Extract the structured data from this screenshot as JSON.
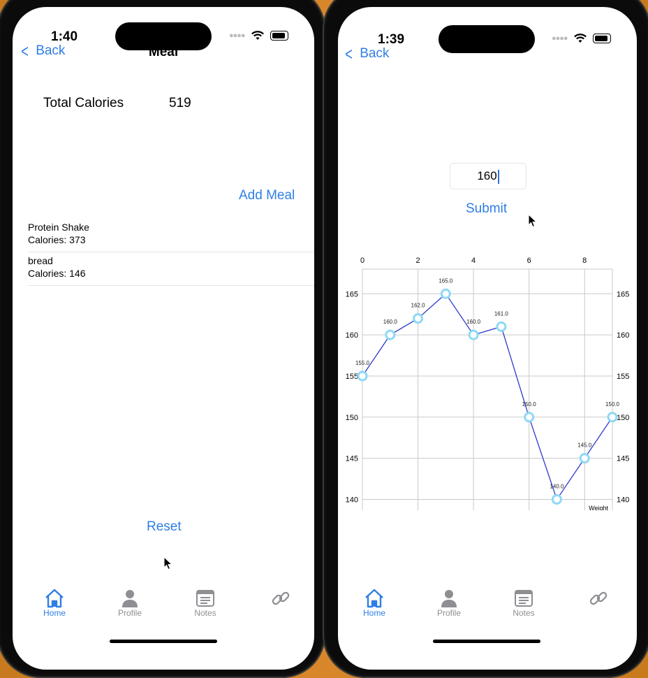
{
  "left": {
    "status": {
      "time": "1:40"
    },
    "nav": {
      "back": "Back",
      "title": "Meal"
    },
    "total_calories": {
      "label": "Total Calories",
      "value": "519"
    },
    "add_meal": "Add Meal",
    "meals": [
      {
        "name": "Protein Shake",
        "calories": "Calories: 373"
      },
      {
        "name": "bread",
        "calories": "Calories: 146"
      }
    ],
    "reset": "Reset",
    "tabs": [
      {
        "label": "Home",
        "icon": "home-icon",
        "active": true
      },
      {
        "label": "Profile",
        "icon": "person-icon",
        "active": false
      },
      {
        "label": "Notes",
        "icon": "notes-icon",
        "active": false
      },
      {
        "label": "",
        "icon": "link-icon",
        "active": false
      }
    ]
  },
  "right": {
    "status": {
      "time": "1:39"
    },
    "nav": {
      "back": "Back"
    },
    "weight_input": {
      "value": "160"
    },
    "submit": "Submit",
    "tabs": [
      {
        "label": "Home",
        "icon": "home-icon",
        "active": true
      },
      {
        "label": "Profile",
        "icon": "person-icon",
        "active": false
      },
      {
        "label": "Notes",
        "icon": "notes-icon",
        "active": false
      },
      {
        "label": "",
        "icon": "link-icon",
        "active": false
      }
    ]
  },
  "colors": {
    "accent": "#2f7ee4",
    "line": "#2a3bc8",
    "marker": "#8fd8f5",
    "legend": "#1633d6"
  },
  "chart_data": {
    "type": "line",
    "x": [
      0,
      1,
      2,
      3,
      4,
      5,
      6,
      7,
      8,
      9
    ],
    "series": [
      {
        "name": "Weight",
        "values": [
          155.0,
          160.0,
          162.0,
          165.0,
          160.0,
          161.0,
          150.0,
          140.0,
          145.0,
          150.0
        ]
      }
    ],
    "data_labels": [
      "155.0",
      "160.0",
      "162.0",
      "165.0",
      "160.0",
      "161.0",
      "150.0",
      "140.0",
      "145.0",
      "150.0"
    ],
    "x_ticks": [
      "0",
      "2",
      "4",
      "6",
      "8"
    ],
    "y_ticks": [
      "140",
      "145",
      "150",
      "155",
      "160",
      "165"
    ],
    "xlim": [
      0,
      9
    ],
    "ylim": [
      138,
      168
    ],
    "x_axis_position": "top",
    "y_axis": "left-and-right",
    "grid": true,
    "axis_description": "Weight",
    "legend": {
      "position": "bottom-left",
      "entries": [
        "Weight"
      ]
    }
  }
}
